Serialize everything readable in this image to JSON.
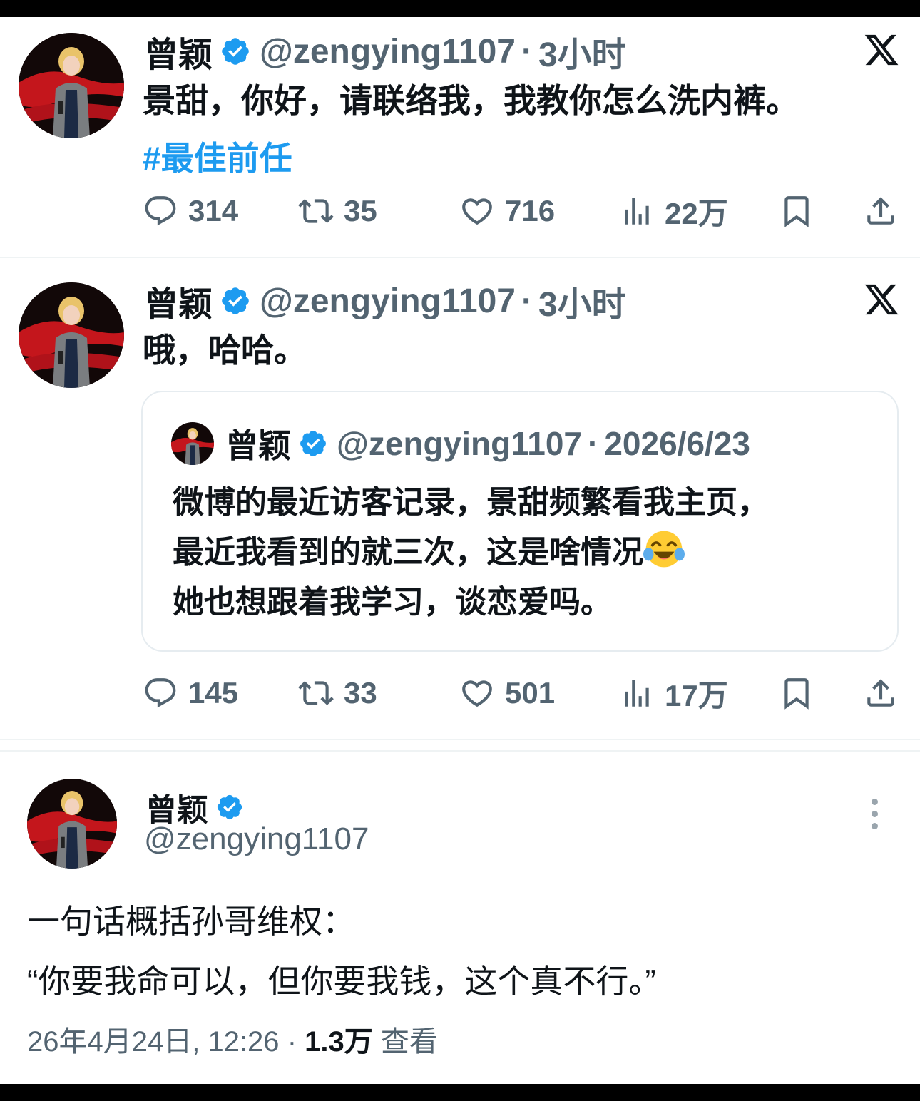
{
  "tweet1": {
    "name": "曾颖",
    "handle": "@zengying1107",
    "time": "3小时",
    "text": "景甜，你好，请联络我，我教你怎么洗内裤。",
    "hashtag": "#最佳前任",
    "replies": "314",
    "retweets": "35",
    "likes": "716",
    "views": "22万"
  },
  "tweet2": {
    "name": "曾颖",
    "handle": "@zengying1107",
    "time": "3小时",
    "text": "哦，哈哈。",
    "quote": {
      "name": "曾颖",
      "handle": "@zengying1107",
      "date": "2026/6/23",
      "line1": "微博的最近访客记录，景甜频繁看我主页，",
      "line2": "最近我看到的就三次，这是啥情况",
      "line3": "她也想跟着我学习，谈恋爱吗。",
      "emoji": "face-with-tears-of-joy"
    },
    "replies": "145",
    "retweets": "33",
    "likes": "501",
    "views": "17万"
  },
  "tweet3": {
    "name": "曾颖",
    "handle": "@zengying1107",
    "line1": "一句话概括孙哥维权：",
    "line2": "“你要我命可以，但你要我钱，这个真不行。”",
    "datetime": "26年4月24日, 12:26",
    "views_count": "1.3万",
    "views_label": "查看"
  },
  "separator": "·",
  "colors": {
    "verified": "#1d9bf0",
    "hashtag": "#1d9bf0",
    "secondary_text": "#536471"
  }
}
